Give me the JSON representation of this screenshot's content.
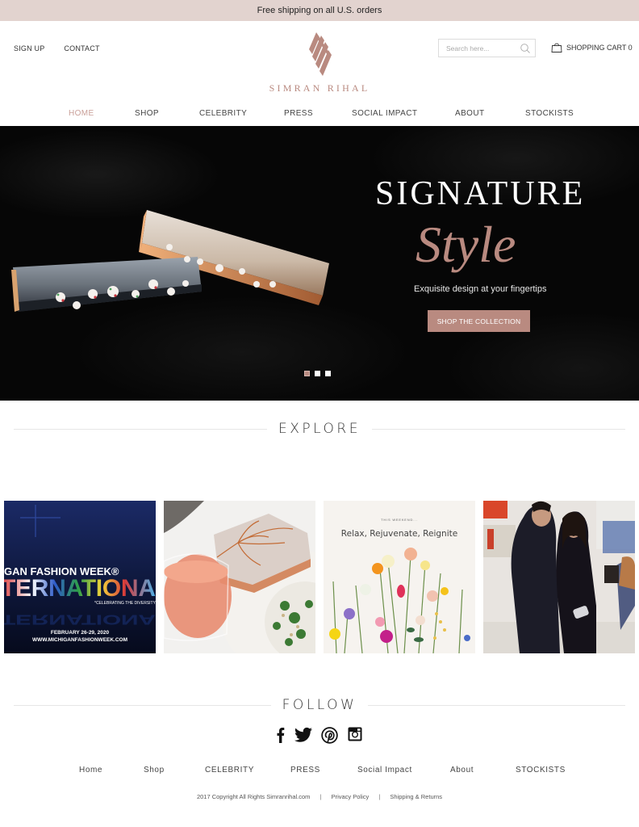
{
  "promo": {
    "text": "Free shipping on all U.S. orders"
  },
  "header": {
    "links": [
      {
        "label": "SIGN UP"
      },
      {
        "label": "CONTACT"
      }
    ],
    "logo": {
      "icon": "sr-monogram-icon",
      "text": "SIMRAN RIHAL"
    },
    "search": {
      "placeholder": "Search here...",
      "value": "",
      "icon": "search-icon"
    },
    "cart": {
      "label": "SHOPPING CART",
      "count": "0",
      "icon": "shopping-bag-icon",
      "display": "SHOPPING CART 0"
    }
  },
  "nav": {
    "items": [
      {
        "label": "HOME",
        "active": true
      },
      {
        "label": "SHOP"
      },
      {
        "label": "CELEBRITY"
      },
      {
        "label": "PRESS"
      },
      {
        "label": "SOCIAL IMPACT"
      },
      {
        "label": "ABOUT"
      },
      {
        "label": "STOCKISTS"
      }
    ]
  },
  "hero": {
    "title": "SIGNATURE",
    "script": "Style",
    "subtitle": "Exquisite design at your fingertips",
    "cta": "SHOP THE COLLECTION",
    "slides": {
      "count": 3,
      "active": 1
    }
  },
  "explore": {
    "heading": "EXPLORE",
    "tiles": [
      {
        "alt": "Michigan Fashion Week International poster",
        "line1": "GAN FASHION WEEK®",
        "line2": "TERNATIONA",
        "tagline": "*CELEBRATING THE DIVERSITY",
        "date": "FEBRUARY 26-29, 2020",
        "url": "WWW.MICHIGANFASHIONWEEK.COM"
      },
      {
        "alt": "Rose gold clutch with drink and salad"
      },
      {
        "alt": "Flowers with weekend message",
        "kicker": "THIS WEEKEND...",
        "headline": "Relax, Rejuvenate, Reignite"
      },
      {
        "alt": "Designer posing with guest in boutique"
      }
    ]
  },
  "follow": {
    "heading": "FOLLOW",
    "icons": [
      "facebook-icon",
      "twitter-icon",
      "pinterest-icon",
      "instagram-icon"
    ]
  },
  "footer": {
    "nav": [
      {
        "label": "Home"
      },
      {
        "label": "Shop"
      },
      {
        "label": "CELEBRITY"
      },
      {
        "label": "PRESS"
      },
      {
        "label": "Social Impact"
      },
      {
        "label": "About"
      },
      {
        "label": "STOCKISTS"
      }
    ],
    "copyright": "2017 Copyright All Rights Simranrihal.com",
    "separator": "|",
    "links": [
      {
        "label": "Privacy Policy"
      },
      {
        "label": "Shipping & Returns"
      }
    ]
  },
  "colors": {
    "accent": "#b98a80",
    "promo_bg": "#e2d3cf",
    "nav_active": "#c99f98",
    "text": "#333333"
  }
}
